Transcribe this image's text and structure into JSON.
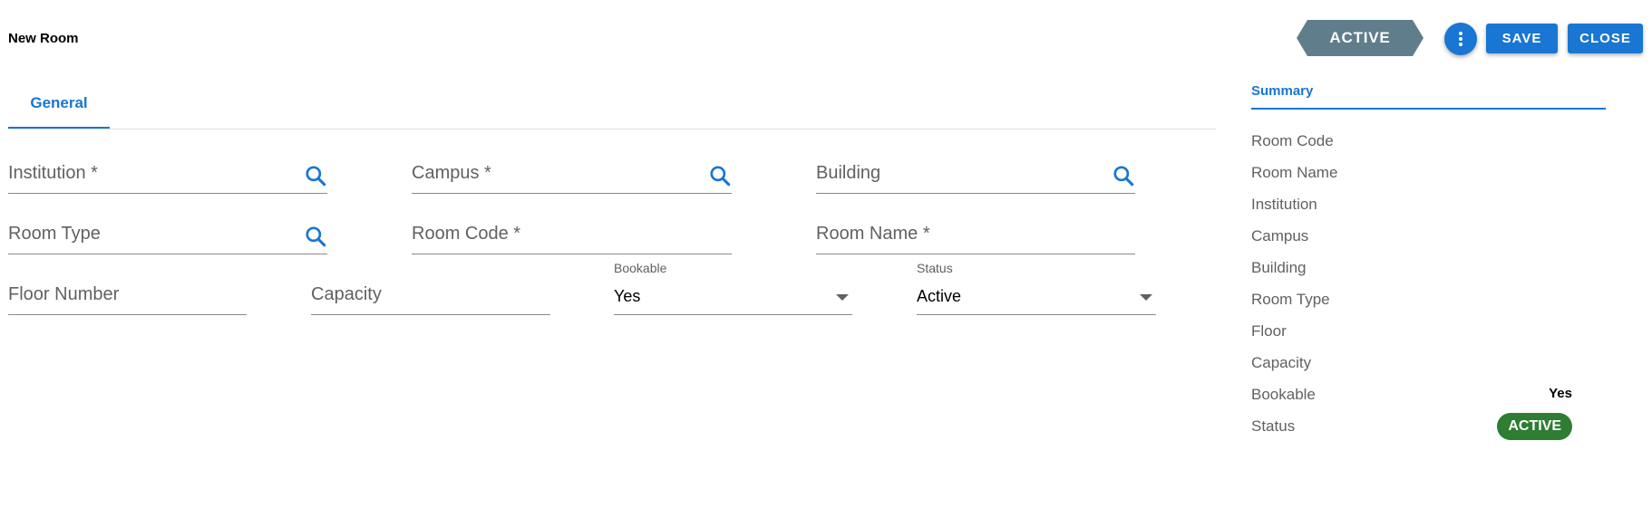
{
  "header": {
    "title": "New Room",
    "status_badge": "ACTIVE",
    "save_label": "SAVE",
    "close_label": "CLOSE",
    "more_icon": "more-vertical-icon"
  },
  "tabs": [
    {
      "label": "General",
      "active": true
    }
  ],
  "form": {
    "institution": {
      "placeholder": "Institution *"
    },
    "campus": {
      "placeholder": "Campus *"
    },
    "building": {
      "placeholder": "Building"
    },
    "room_type": {
      "placeholder": "Room Type"
    },
    "room_code": {
      "placeholder": "Room Code *"
    },
    "room_name": {
      "placeholder": "Room Name *"
    },
    "floor_number": {
      "placeholder": "Floor Number"
    },
    "capacity": {
      "placeholder": "Capacity"
    },
    "bookable": {
      "label": "Bookable",
      "value": "Yes"
    },
    "status": {
      "label": "Status",
      "value": "Active"
    },
    "search_icon": "search-icon"
  },
  "summary": {
    "title": "Summary",
    "rows": [
      {
        "key": "Room Code",
        "value": ""
      },
      {
        "key": "Room Name",
        "value": ""
      },
      {
        "key": "Institution",
        "value": ""
      },
      {
        "key": "Campus",
        "value": ""
      },
      {
        "key": "Building",
        "value": ""
      },
      {
        "key": "Room Type",
        "value": ""
      },
      {
        "key": "Floor",
        "value": ""
      },
      {
        "key": "Capacity",
        "value": ""
      },
      {
        "key": "Bookable",
        "value": "Yes"
      },
      {
        "key": "Status",
        "value": "ACTIVE"
      }
    ]
  },
  "colors": {
    "primary": "#1976d2",
    "status_ribbon": "#607d8b",
    "status_chip": "#2e7d32"
  }
}
